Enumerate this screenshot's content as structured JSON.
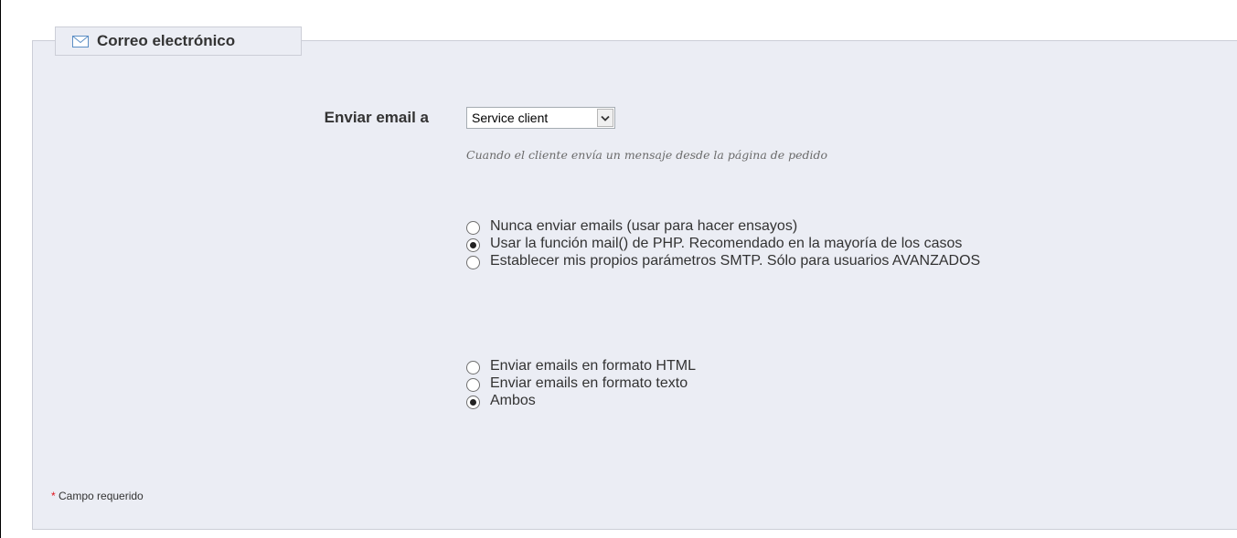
{
  "section": {
    "title": "Correo electrónico",
    "icon": "envelope-icon"
  },
  "send_email_to": {
    "label": "Enviar email a",
    "selected_value": "Service client",
    "hint": "Cuando el cliente envía un mensaje desde la página de pedido"
  },
  "mail_method": {
    "options": [
      {
        "label": "Nunca enviar emails (usar para hacer ensayos)",
        "checked": false
      },
      {
        "label": "Usar la función mail() de PHP. Recomendado en la mayoría de los casos",
        "checked": true
      },
      {
        "label": "Establecer mis propios parámetros SMTP. Sólo para usuarios AVANZADOS",
        "checked": false
      }
    ]
  },
  "mail_format": {
    "options": [
      {
        "label": "Enviar emails en formato HTML",
        "checked": false
      },
      {
        "label": "Enviar emails en formato texto",
        "checked": false
      },
      {
        "label": "Ambos",
        "checked": true
      }
    ]
  },
  "footer": {
    "required_star": "*",
    "required_text": "Campo requerido"
  },
  "colors": {
    "panel_background": "#ebedf4",
    "panel_border": "#ccced7",
    "required_star": "#e0131c"
  }
}
